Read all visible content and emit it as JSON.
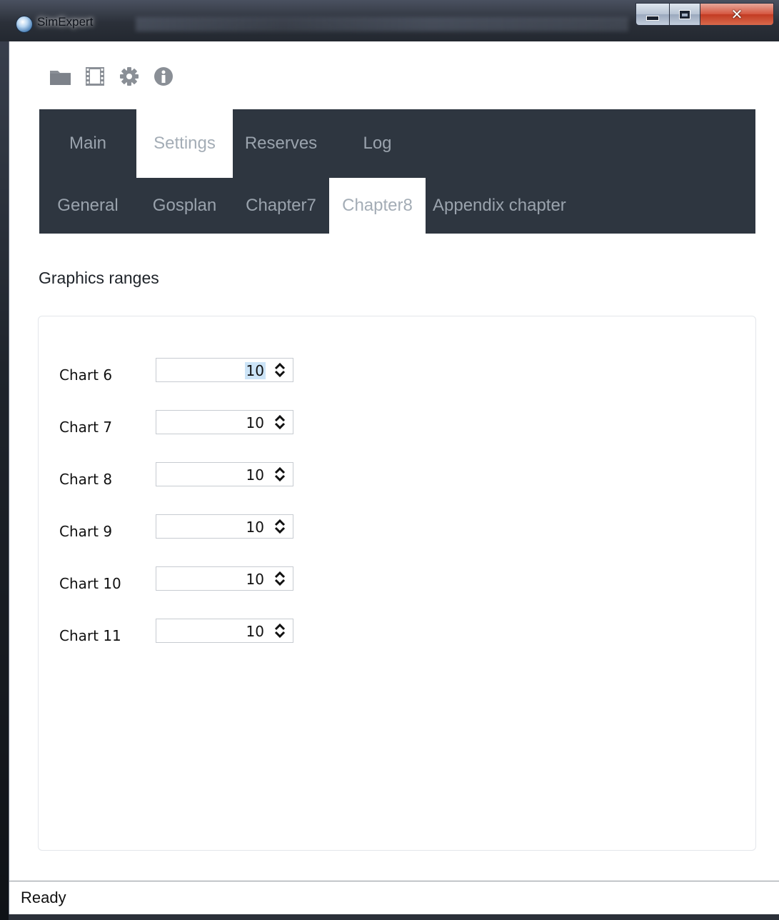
{
  "window": {
    "title": "SimExpert"
  },
  "toolbar": {
    "icons": [
      "folder-icon",
      "film-icon",
      "gear-icon",
      "info-icon"
    ]
  },
  "tabs": {
    "main": [
      {
        "label": "Main",
        "selected": false
      },
      {
        "label": "Settings",
        "selected": true
      },
      {
        "label": "Reserves",
        "selected": false
      },
      {
        "label": "Log",
        "selected": false
      }
    ],
    "sub": [
      {
        "label": "General",
        "selected": false
      },
      {
        "label": "Gosplan",
        "selected": false
      },
      {
        "label": "Chapter7",
        "selected": false
      },
      {
        "label": "Chapter8",
        "selected": true
      },
      {
        "label": "Appendix chapter",
        "selected": false
      }
    ]
  },
  "content": {
    "section_title": "Graphics ranges",
    "charts": [
      {
        "label": "Chart 6",
        "value": "10",
        "highlighted": true
      },
      {
        "label": "Chart 7",
        "value": "10",
        "highlighted": false
      },
      {
        "label": "Chart 8",
        "value": "10",
        "highlighted": false
      },
      {
        "label": "Chart 9",
        "value": "10",
        "highlighted": false
      },
      {
        "label": "Chart 10",
        "value": "10",
        "highlighted": false
      },
      {
        "label": "Chart 11",
        "value": "10",
        "highlighted": false
      }
    ]
  },
  "status": {
    "text": "Ready"
  },
  "colors": {
    "tab_band": "#2e3640",
    "tab_text": "#9aa3ad",
    "selection_highlight": "#cce4f7"
  }
}
